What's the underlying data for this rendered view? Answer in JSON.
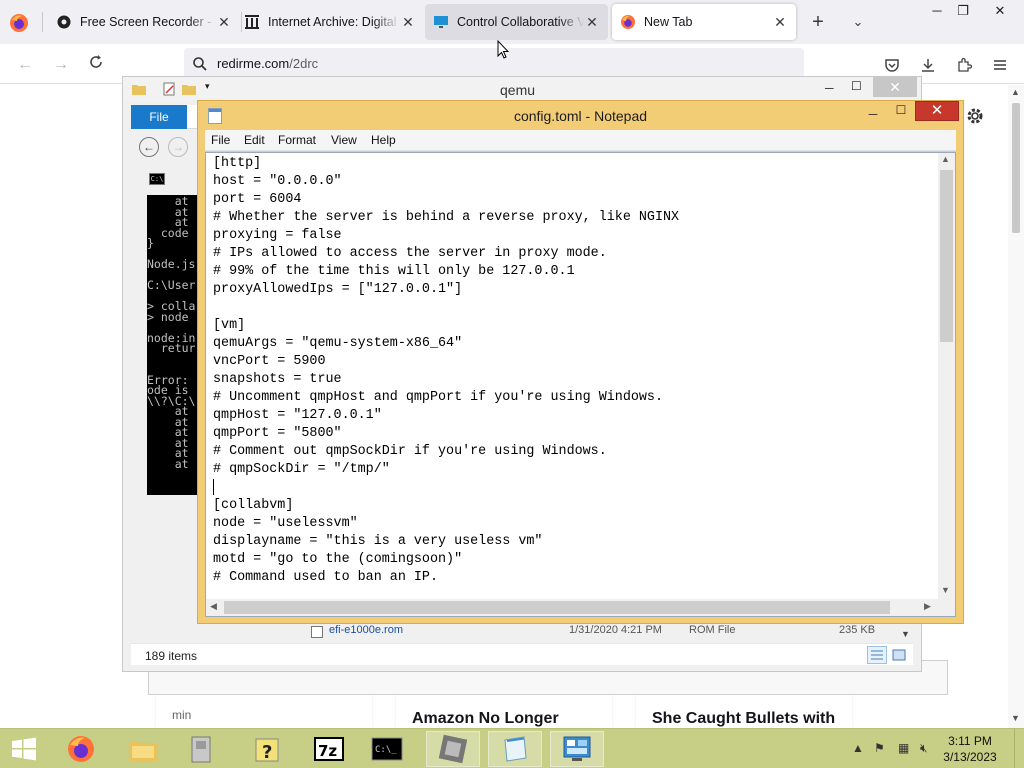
{
  "browser": {
    "tabs": [
      {
        "title": "Free Screen Recorder - N",
        "icon": "gear-icon",
        "state": "normal"
      },
      {
        "title": "Internet Archive: Digital L",
        "icon": "archive-icon",
        "state": "normal"
      },
      {
        "title": "Control Collaborative V",
        "icon": "monitor-icon",
        "state": "hover"
      },
      {
        "title": "New Tab",
        "icon": "firefox-icon",
        "state": "active"
      }
    ],
    "url_host": "redirme.com",
    "url_path": "/2drc"
  },
  "page": {
    "cards": [
      {
        "meta": "min",
        "headline": ""
      },
      {
        "meta": "",
        "headline": "Amazon No Longer"
      },
      {
        "meta": "",
        "headline": "She Caught Bullets with"
      }
    ]
  },
  "qemu": {
    "title": "qemu",
    "file_tab": "File",
    "console_lines": [
      "    at",
      "    at",
      "    at",
      "  code",
      "}",
      "",
      "Node.js",
      "",
      "C:\\User",
      "",
      "> colla",
      "> node",
      "",
      "node:in",
      "  retur",
      "",
      "",
      "Error:",
      "ode is",
      "\\\\?\\C:\\",
      "    at",
      "    at",
      "    at",
      "    at",
      "    at",
      "    at"
    ],
    "file_row": {
      "name": "efi-e1000e.rom",
      "date": "1/31/2020 4:21 PM",
      "type": "ROM File",
      "size": "235 KB"
    },
    "status_items": "189 items"
  },
  "notepad": {
    "title": "config.toml - Notepad",
    "menu": [
      "File",
      "Edit",
      "Format",
      "View",
      "Help"
    ],
    "lines": [
      "[http]",
      "host = \"0.0.0.0\"",
      "port = 6004",
      "# Whether the server is behind a reverse proxy, like NGINX",
      "proxying = false",
      "# IPs allowed to access the server in proxy mode.",
      "# 99% of the time this will only be 127.0.0.1",
      "proxyAllowedIps = [\"127.0.0.1\"]",
      "",
      "[vm]",
      "qemuArgs = \"qemu-system-x86_64\"",
      "vncPort = 5900",
      "snapshots = true",
      "# Uncomment qmpHost and qmpPort if you're using Windows.",
      "qmpHost = \"127.0.0.1\"",
      "qmpPort = \"5800\"",
      "# Comment out qmpSockDir if you're using Windows.",
      "# qmpSockDir = \"/tmp/\"",
      "",
      "[collabvm]",
      "node = \"uselessvm\"",
      "displayname = \"this is a very useless vm\"",
      "motd = \"go to the (comingsoon)\"",
      "# Command used to ban an IP."
    ]
  },
  "taskbar": {
    "apps": [
      "firefox-icon",
      "file-explorer-icon",
      "archive-icon",
      "help-icon",
      "7zip-icon",
      "cmd-icon",
      "qemu-icon",
      "notepad-icon",
      "control-panel-icon"
    ],
    "clock_time": "3:11 PM",
    "clock_date": "3/13/2023",
    "colors": {
      "taskbar": "#c7cf86",
      "notepad_frame": "#f3cd76",
      "close_red": "#c7372b"
    }
  }
}
